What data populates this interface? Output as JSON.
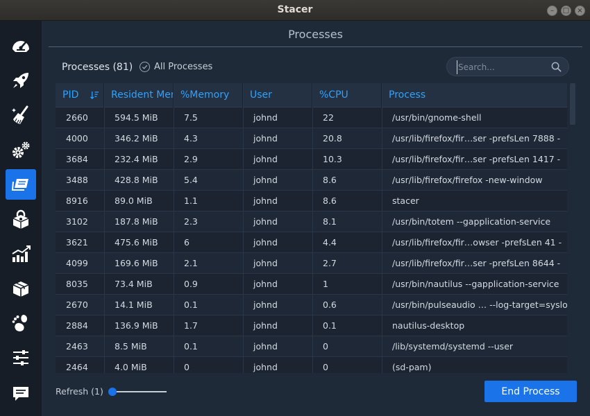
{
  "window": {
    "title": "Stacer"
  },
  "sidebar": {
    "items": [
      {
        "name": "dashboard",
        "icon": "speedometer-icon"
      },
      {
        "name": "startup-apps",
        "icon": "rocket-icon"
      },
      {
        "name": "system-cleaner",
        "icon": "broom-icon"
      },
      {
        "name": "services",
        "icon": "gears-icon"
      },
      {
        "name": "processes",
        "icon": "processes-icon",
        "active": true
      },
      {
        "name": "uninstaller",
        "icon": "package-lock-icon"
      },
      {
        "name": "resources",
        "icon": "bar-chart-icon"
      },
      {
        "name": "apt-repository",
        "icon": "box-icon"
      },
      {
        "name": "gnome-settings",
        "icon": "gnome-foot-icon"
      },
      {
        "name": "settings",
        "icon": "sliders-icon"
      },
      {
        "name": "feedback",
        "icon": "chat-icon"
      }
    ],
    "active_color": "#1a73e8"
  },
  "header": {
    "title": "Processes"
  },
  "toolbar": {
    "count_label": "Processes (81)",
    "all_processes_label": "All Processes",
    "search_placeholder": "Search..."
  },
  "table": {
    "columns": [
      "PID",
      "Resident Memory",
      "%Memory",
      "User",
      "%CPU",
      "Process"
    ],
    "sort_column": "PID",
    "rows": [
      [
        "2660",
        "594.5 MiB",
        "7.5",
        "johnd",
        "22",
        "/usr/bin/gnome-shell"
      ],
      [
        "4000",
        "346.2 MiB",
        "4.3",
        "johnd",
        "20.8",
        "/usr/lib/firefox/fir…ser -prefsLen 7888 -"
      ],
      [
        "3684",
        "232.4 MiB",
        "2.9",
        "johnd",
        "10.3",
        "/usr/lib/firefox/fir…ser -prefsLen 1417 -"
      ],
      [
        "3488",
        "428.8 MiB",
        "5.4",
        "johnd",
        "8.6",
        "/usr/lib/firefox/firefox -new-window"
      ],
      [
        "8916",
        "89.0 MiB",
        "1.1",
        "johnd",
        "8.6",
        "stacer"
      ],
      [
        "3102",
        "187.8 MiB",
        "2.3",
        "johnd",
        "8.1",
        "/usr/bin/totem --gapplication-service"
      ],
      [
        "3621",
        "475.6 MiB",
        "6",
        "johnd",
        "4.4",
        "/usr/lib/firefox/fir…owser -prefsLen 41 -"
      ],
      [
        "4099",
        "169.6 MiB",
        "2.1",
        "johnd",
        "2.7",
        "/usr/lib/firefox/fir…ser -prefsLen 8644 -"
      ],
      [
        "8035",
        "73.4 MiB",
        "0.9",
        "johnd",
        "1",
        "/usr/bin/nautilus --gapplication-service"
      ],
      [
        "2670",
        "14.1 MiB",
        "0.1",
        "johnd",
        "0.6",
        "/usr/bin/pulseaudio … --log-target=syslog"
      ],
      [
        "2884",
        "136.9 MiB",
        "1.7",
        "johnd",
        "0.1",
        "nautilus-desktop"
      ],
      [
        "2463",
        "8.5 MiB",
        "0.1",
        "johnd",
        "0",
        "/lib/systemd/systemd --user"
      ],
      [
        "2464",
        "4.0 MiB",
        "0",
        "johnd",
        "0",
        "(sd-pam)"
      ]
    ]
  },
  "footer": {
    "refresh_label": "Refresh (1)",
    "refresh_value": 1,
    "end_button_label": "End Process"
  }
}
